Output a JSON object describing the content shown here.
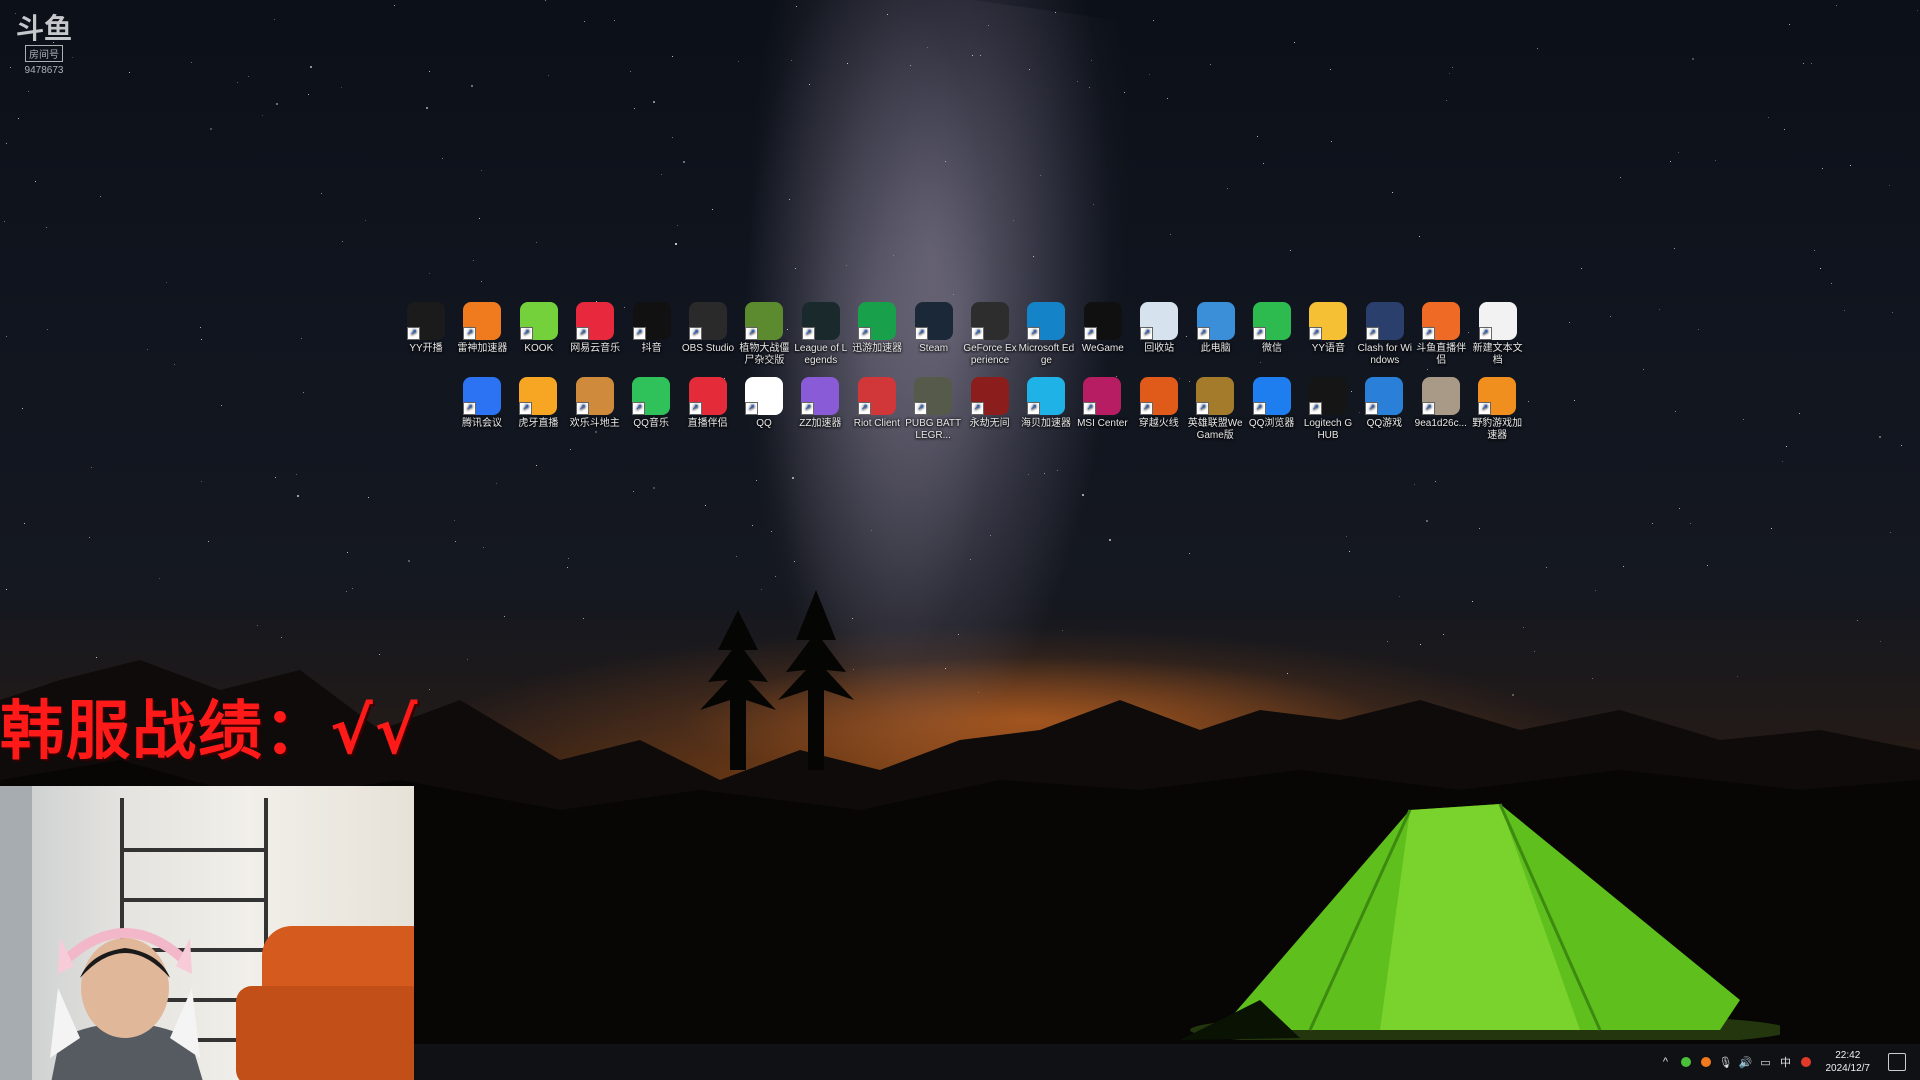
{
  "watermark": {
    "logo_text": "斗鱼",
    "logo_sub": "房间号",
    "room_id": "9478673"
  },
  "desktop_icons_row1": [
    {
      "label": "YY开播",
      "icon": "yy-live-icon",
      "color": "#1b1b1b"
    },
    {
      "label": "雷神加速器",
      "icon": "leishen-icon",
      "color": "#f07b1e"
    },
    {
      "label": "KOOK",
      "icon": "kook-icon",
      "color": "#74d13b"
    },
    {
      "label": "网易云音乐",
      "icon": "netease-music-icon",
      "color": "#e8283c"
    },
    {
      "label": "抖音",
      "icon": "douyin-icon",
      "color": "#111111"
    },
    {
      "label": "OBS Studio",
      "icon": "obs-icon",
      "color": "#2a2a2a"
    },
    {
      "label": "植物大战僵尸杂交版",
      "icon": "pvz-icon",
      "color": "#5c8a2e"
    },
    {
      "label": "League of Legends",
      "icon": "lol-icon",
      "color": "#1a2a2c"
    },
    {
      "label": "迅游加速器",
      "icon": "xunyou-icon",
      "color": "#18a04a"
    },
    {
      "label": "Steam",
      "icon": "steam-icon",
      "color": "#1b2838"
    },
    {
      "label": "GeForce Experience",
      "icon": "geforce-icon",
      "color": "#2d2d2d"
    },
    {
      "label": "Microsoft Edge",
      "icon": "edge-icon",
      "color": "#1583c8"
    },
    {
      "label": "WeGame",
      "icon": "wegame-icon",
      "color": "#101010"
    },
    {
      "label": "回收站",
      "icon": "recycle-bin-icon",
      "color": "#d6e2ee"
    },
    {
      "label": "此电脑",
      "icon": "this-pc-icon",
      "color": "#3b8ed8"
    },
    {
      "label": "微信",
      "icon": "wechat-icon",
      "color": "#2dbb4f"
    },
    {
      "label": "YY语音",
      "icon": "yy-voice-icon",
      "color": "#f5c033"
    },
    {
      "label": "Clash for Windows",
      "icon": "clash-icon",
      "color": "#2a3f6c"
    },
    {
      "label": "斗鱼直播伴侣",
      "icon": "douyu-companion-icon",
      "color": "#ef6a24"
    },
    {
      "label": "新建文本文档",
      "icon": "text-document-icon",
      "color": "#f2f2f2"
    }
  ],
  "desktop_icons_row2": [
    {
      "label": "腾讯会议",
      "icon": "tencent-meeting-icon",
      "color": "#2b73f3"
    },
    {
      "label": "虎牙直播",
      "icon": "huya-icon",
      "color": "#f7a623"
    },
    {
      "label": "欢乐斗地主",
      "icon": "doudizhu-icon",
      "color": "#d08a3c"
    },
    {
      "label": "QQ音乐",
      "icon": "qq-music-icon",
      "color": "#2fc15a"
    },
    {
      "label": "直播伴侣",
      "icon": "live-companion-icon",
      "color": "#e32b3a"
    },
    {
      "label": "QQ",
      "icon": "qq-icon",
      "color": "#ffffff"
    },
    {
      "label": "ZZ加速器",
      "icon": "zz-accelerator-icon",
      "color": "#8a5bd6"
    },
    {
      "label": "Riot Client",
      "icon": "riot-client-icon",
      "color": "#d13639"
    },
    {
      "label": "PUBG BATTLEGR...",
      "icon": "pubg-icon",
      "color": "#555a4a"
    },
    {
      "label": "永劫无间",
      "icon": "naraka-icon",
      "color": "#8b1d1d"
    },
    {
      "label": "海贝加速器",
      "icon": "haibei-icon",
      "color": "#1fb2e6"
    },
    {
      "label": "MSI Center",
      "icon": "msi-center-icon",
      "color": "#b61d63"
    },
    {
      "label": "穿越火线",
      "icon": "crossfire-icon",
      "color": "#e05a1a"
    },
    {
      "label": "英雄联盟WeGame版",
      "icon": "lol-wegame-icon",
      "color": "#a37b2b"
    },
    {
      "label": "QQ浏览器",
      "icon": "qq-browser-icon",
      "color": "#1e7ef0"
    },
    {
      "label": "Logitech G HUB",
      "icon": "logitech-icon",
      "color": "#151515"
    },
    {
      "label": "QQ游戏",
      "icon": "qq-game-icon",
      "color": "#2a7fd8"
    },
    {
      "label": "9ea1d26c...",
      "icon": "image-file-icon",
      "color": "#a89a86"
    },
    {
      "label": "野豹游戏加速器",
      "icon": "yebao-icon",
      "color": "#f08f1e"
    }
  ],
  "overlay": {
    "text": "韩服战绩：√√",
    "color": "#ff1a1a"
  },
  "taskbar": {
    "tray_icons": [
      "chevron-up-icon",
      "green-status-icon",
      "douyu-tray-icon",
      "microphone-icon",
      "volume-icon",
      "network-icon",
      "ime-icon",
      "app-tray-icon"
    ],
    "ime_label": "中",
    "time": "22:42",
    "date": "2024/12/7"
  }
}
